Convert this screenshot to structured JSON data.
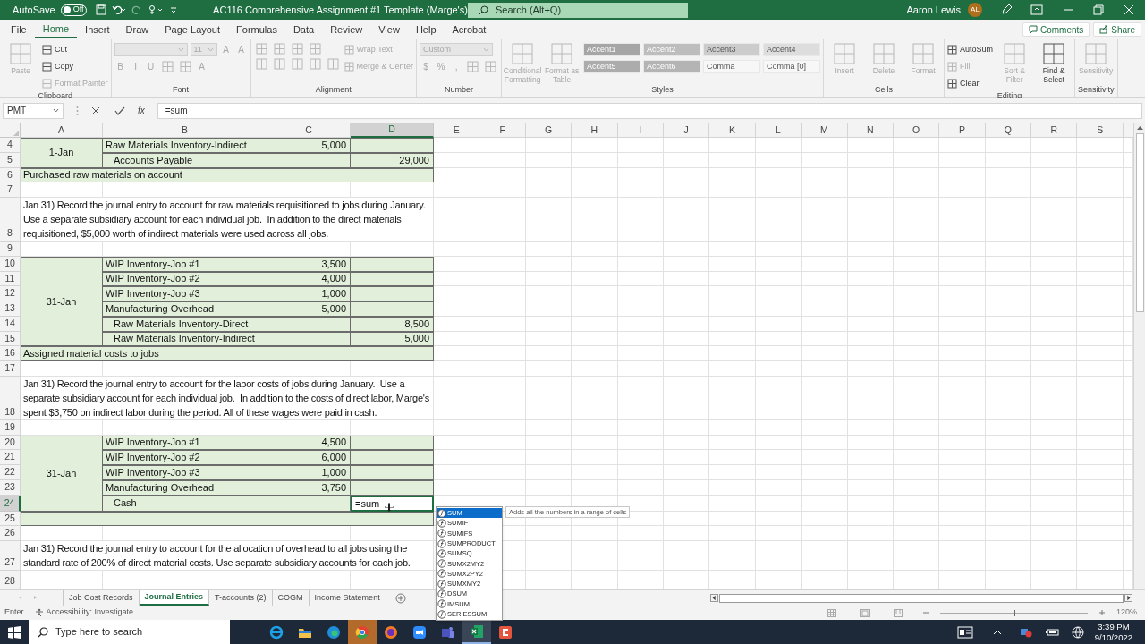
{
  "title_bar": {
    "autosave_label": "AutoSave",
    "autosave": {
      "on": false,
      "label": "Off"
    },
    "document_title": "AC116 Comprehensive Assignment #1 Template (Marge's)",
    "search_placeholder": "Search (Alt+Q)",
    "user_name": "Aaron Lewis",
    "user_initials": "AL"
  },
  "ribbon_tabs": [
    {
      "label": "File",
      "selected": false
    },
    {
      "label": "Home",
      "selected": true
    },
    {
      "label": "Insert",
      "selected": false
    },
    {
      "label": "Draw",
      "selected": false
    },
    {
      "label": "Page Layout",
      "selected": false
    },
    {
      "label": "Formulas",
      "selected": false
    },
    {
      "label": "Data",
      "selected": false
    },
    {
      "label": "Review",
      "selected": false
    },
    {
      "label": "View",
      "selected": false
    },
    {
      "label": "Help",
      "selected": false
    },
    {
      "label": "Acrobat",
      "selected": false
    }
  ],
  "ribbon_actions": [
    "Comments",
    "Share"
  ],
  "ribbon_groups": [
    {
      "label": "Clipboard",
      "stacks": [
        {
          "rows": [
            [
              {
                "kind": "large",
                "label": "Paste",
                "disabled": true
              }
            ]
          ]
        },
        {
          "rows": [
            [
              {
                "kind": "small",
                "label": "Cut",
                "disabled": false
              }
            ],
            [
              {
                "kind": "small",
                "label": "Copy",
                "disabled": false
              }
            ],
            [
              {
                "kind": "small",
                "label": "Format Painter",
                "disabled": true
              }
            ]
          ]
        }
      ]
    },
    {
      "label": "Font",
      "stacks": [
        {
          "rows": [
            [
              {
                "kind": "field",
                "wide": true,
                "disabled": true
              },
              {
                "kind": "field",
                "wide": false,
                "value": "11",
                "disabled": true
              },
              {
                "kind": "glyph",
                "text": "A",
                "disabled": true
              },
              {
                "kind": "glyph",
                "text": "A",
                "disabled": true
              }
            ],
            [
              {
                "kind": "glyph",
                "text": "B",
                "disabled": true
              },
              {
                "kind": "glyph",
                "text": "I",
                "disabled": true
              },
              {
                "kind": "glyph",
                "text": "U",
                "disabled": true
              },
              {
                "kind": "icon",
                "disabled": true
              },
              {
                "kind": "icon",
                "disabled": true
              },
              {
                "kind": "glyph",
                "text": "A",
                "disabled": true
              }
            ]
          ]
        }
      ]
    },
    {
      "label": "Alignment",
      "stacks": [
        {
          "rows": [
            [
              {
                "kind": "icon",
                "disabled": true
              },
              {
                "kind": "icon",
                "disabled": true
              },
              {
                "kind": "icon",
                "disabled": true
              },
              {
                "kind": "icon",
                "disabled": true
              }
            ],
            [
              {
                "kind": "icon",
                "disabled": true
              },
              {
                "kind": "icon",
                "disabled": true
              },
              {
                "kind": "icon",
                "disabled": true
              },
              {
                "kind": "icon",
                "disabled": true
              },
              {
                "kind": "icon",
                "disabled": true
              }
            ]
          ]
        },
        {
          "rows": [
            [
              {
                "kind": "small",
                "label": "Wrap Text",
                "disabled": true
              }
            ],
            [
              {
                "kind": "small",
                "label": "Merge & Center",
                "disabled": true
              }
            ]
          ]
        }
      ]
    },
    {
      "label": "Number",
      "stacks": [
        {
          "rows": [
            [
              {
                "kind": "field",
                "wide": true,
                "value": "Custom",
                "disabled": true
              }
            ],
            [
              {
                "kind": "glyph",
                "text": "$",
                "disabled": true
              },
              {
                "kind": "glyph",
                "text": "%",
                "disabled": true
              },
              {
                "kind": "glyph",
                "text": ",",
                "disabled": true
              },
              {
                "kind": "icon",
                "disabled": true
              },
              {
                "kind": "icon",
                "disabled": true
              }
            ]
          ]
        }
      ]
    },
    {
      "label": "Styles",
      "stacks": [
        {
          "rows": [
            [
              {
                "kind": "large",
                "label": "Conditional Formatting",
                "disabled": true
              }
            ]
          ]
        },
        {
          "rows": [
            [
              {
                "kind": "large",
                "label": "Format as Table",
                "disabled": true
              }
            ]
          ]
        },
        {
          "rows": [
            [
              {
                "kind": "style",
                "label": "Accent1",
                "color": "#a6a6a6"
              },
              {
                "kind": "style",
                "label": "Accent2",
                "color": "#bdbdbd"
              },
              {
                "kind": "style",
                "label": "Accent3",
                "color": "#cccccc"
              },
              {
                "kind": "style",
                "label": "Accent4",
                "color": "#dddddd"
              }
            ],
            [
              {
                "kind": "style",
                "label": "Accent5",
                "color": "#acacac"
              },
              {
                "kind": "style",
                "label": "Accent6",
                "color": "#b4b4b4"
              },
              {
                "kind": "style",
                "label": "Comma",
                "color": "#f7f7f7"
              },
              {
                "kind": "style",
                "label": "Comma [0]",
                "color": "#f7f7f7"
              }
            ]
          ]
        }
      ]
    },
    {
      "label": "Cells",
      "stacks": [
        {
          "rows": [
            [
              {
                "kind": "large",
                "label": "Insert",
                "disabled": true
              }
            ]
          ]
        },
        {
          "rows": [
            [
              {
                "kind": "large",
                "label": "Delete",
                "disabled": true
              }
            ]
          ]
        },
        {
          "rows": [
            [
              {
                "kind": "large",
                "label": "Format",
                "disabled": true
              }
            ]
          ]
        }
      ]
    },
    {
      "label": "Editing",
      "stacks": [
        {
          "rows": [
            [
              {
                "kind": "small",
                "label": "AutoSum",
                "disabled": false
              }
            ],
            [
              {
                "kind": "small",
                "label": "Fill",
                "disabled": true
              }
            ],
            [
              {
                "kind": "small",
                "label": "Clear",
                "disabled": false
              }
            ]
          ]
        },
        {
          "rows": [
            [
              {
                "kind": "large",
                "label": "Sort & Filter",
                "disabled": true
              }
            ]
          ]
        },
        {
          "rows": [
            [
              {
                "kind": "large",
                "label": "Find & Select",
                "disabled": false
              }
            ]
          ]
        }
      ]
    },
    {
      "label": "Sensitivity",
      "stacks": [
        {
          "rows": [
            [
              {
                "kind": "large",
                "label": "Sensitivity",
                "disabled": true
              }
            ]
          ]
        }
      ]
    }
  ],
  "formula_bar": {
    "name_box": "PMT",
    "function_button": "fx",
    "formula": "=sum"
  },
  "sheet": {
    "columns": [
      {
        "label": "A",
        "selected": false
      },
      {
        "label": "B",
        "selected": false
      },
      {
        "label": "C",
        "selected": false
      },
      {
        "label": "D",
        "selected": true
      },
      {
        "label": "E",
        "selected": false
      },
      {
        "label": "F",
        "selected": false
      },
      {
        "label": "G",
        "selected": false
      },
      {
        "label": "H",
        "selected": false
      },
      {
        "label": "I",
        "selected": false
      },
      {
        "label": "J",
        "selected": false
      },
      {
        "label": "K",
        "selected": false
      },
      {
        "label": "L",
        "selected": false
      },
      {
        "label": "M",
        "selected": false
      },
      {
        "label": "N",
        "selected": false
      },
      {
        "label": "O",
        "selected": false
      },
      {
        "label": "P",
        "selected": false
      },
      {
        "label": "Q",
        "selected": false
      },
      {
        "label": "R",
        "selected": false
      },
      {
        "label": "S",
        "selected": false
      }
    ],
    "rows": [
      {
        "label": "4",
        "selected": false,
        "kind": "entry",
        "date": "1-Jan",
        "account": "Raw Materials Inventory-Indirect",
        "indented": false,
        "debit": "5,000",
        "editing": false
      },
      {
        "label": "5",
        "selected": false,
        "kind": "entry",
        "account": "Accounts Payable",
        "indented": true,
        "credit": "29,000",
        "editing": false
      },
      {
        "label": "6",
        "selected": false,
        "kind": "memo",
        "text": "Purchased raw materials on account"
      },
      {
        "label": "7",
        "selected": false,
        "kind": "blank"
      },
      {
        "label": "8",
        "selected": false,
        "kind": "note",
        "text": "Jan 31) Record the journal entry to account for raw materials requisitioned to jobs during January.  Use a separate subsidiary account for each individual job.  In addition to the direct materials requisitioned, $5,000 worth of indirect materials were used across all jobs."
      },
      {
        "label": "9",
        "selected": false,
        "kind": "blank"
      },
      {
        "label": "10",
        "selected": false,
        "kind": "entry",
        "date": "31-Jan",
        "account": "WIP Inventory-Job #1",
        "indented": false,
        "debit": "3,500",
        "editing": false
      },
      {
        "label": "11",
        "selected": false,
        "kind": "entry",
        "account": "WIP Inventory-Job #2",
        "indented": false,
        "debit": "4,000",
        "editing": false
      },
      {
        "label": "12",
        "selected": false,
        "kind": "entry",
        "account": "WIP Inventory-Job #3",
        "indented": false,
        "debit": "1,000",
        "editing": false
      },
      {
        "label": "13",
        "selected": false,
        "kind": "entry",
        "account": "Manufacturing Overhead",
        "indented": false,
        "debit": "5,000",
        "editing": false
      },
      {
        "label": "14",
        "selected": false,
        "kind": "entry",
        "account": "Raw Materials Inventory-Direct",
        "indented": true,
        "credit": "8,500",
        "editing": false
      },
      {
        "label": "15",
        "selected": false,
        "kind": "entry",
        "account": "Raw Materials Inventory-Indirect",
        "indented": true,
        "credit": "5,000",
        "editing": false
      },
      {
        "label": "16",
        "selected": false,
        "kind": "memo",
        "text": "Assigned material costs to jobs"
      },
      {
        "label": "17",
        "selected": false,
        "kind": "blank"
      },
      {
        "label": "18",
        "selected": false,
        "kind": "note",
        "text": "Jan 31) Record the journal entry to account for the labor costs of jobs during January.  Use a separate subsidiary account for each individual job.  In addition to the costs of direct labor, Marge's spent $3,750 on indirect labor during the period. All of these wages were paid in cash."
      },
      {
        "label": "19",
        "selected": false,
        "kind": "blank"
      },
      {
        "label": "20",
        "selected": false,
        "kind": "entry",
        "date": "31-Jan",
        "account": "WIP Inventory-Job #1",
        "indented": false,
        "debit": "4,500",
        "editing": false
      },
      {
        "label": "21",
        "selected": false,
        "kind": "entry",
        "account": "WIP Inventory-Job #2",
        "indented": false,
        "debit": "6,000",
        "editing": false
      },
      {
        "label": "22",
        "selected": false,
        "kind": "entry",
        "account": "WIP Inventory-Job #3",
        "indented": false,
        "debit": "1,000",
        "editing": false
      },
      {
        "label": "23",
        "selected": false,
        "kind": "entry",
        "account": "Manufacturing Overhead",
        "indented": false,
        "debit": "3,750",
        "editing": false
      },
      {
        "label": "24",
        "selected": true,
        "kind": "entry",
        "account": "Cash",
        "indented": true,
        "input": "=sum",
        "editing": true
      },
      {
        "label": "25",
        "selected": false,
        "kind": "memo"
      },
      {
        "label": "26",
        "selected": false,
        "kind": "blank"
      },
      {
        "label": "27",
        "selected": false,
        "kind": "note",
        "text": "Jan 31) Record the journal entry to account for the allocation of overhead to all jobs using the standard rate of 200% of direct material costs. Use separate subsidiary accounts for each job."
      },
      {
        "label": "28",
        "selected": false,
        "kind": "blank"
      }
    ]
  },
  "autocomplete": {
    "items": [
      {
        "label": "SUM",
        "selected": true
      },
      {
        "label": "SUMIF",
        "selected": false
      },
      {
        "label": "SUMIFS",
        "selected": false
      },
      {
        "label": "SUMPRODUCT",
        "selected": false
      },
      {
        "label": "SUMSQ",
        "selected": false
      },
      {
        "label": "SUMX2MY2",
        "selected": false
      },
      {
        "label": "SUMX2PY2",
        "selected": false
      },
      {
        "label": "SUMXMY2",
        "selected": false
      },
      {
        "label": "DSUM",
        "selected": false
      },
      {
        "label": "IMSUM",
        "selected": false
      },
      {
        "label": "SERIESSUM",
        "selected": false
      }
    ],
    "tooltip": "Adds all the numbers in a range of cells"
  },
  "sheet_tabs": [
    {
      "label": "Job Cost Records",
      "selected": false
    },
    {
      "label": "Journal Entries",
      "selected": true
    },
    {
      "label": "T-accounts (2)",
      "selected": false
    },
    {
      "label": "COGM",
      "selected": false
    },
    {
      "label": "Income Statement",
      "selected": false
    }
  ],
  "status_bar": {
    "mode": "Enter",
    "accessibility": "Accessibility: Investigate",
    "zoom": {
      "level": 0.5,
      "reading": "120%"
    }
  },
  "taskbar": {
    "search_placeholder": "Type here to search",
    "time": "3:39 PM",
    "date": "9/10/2022"
  }
}
